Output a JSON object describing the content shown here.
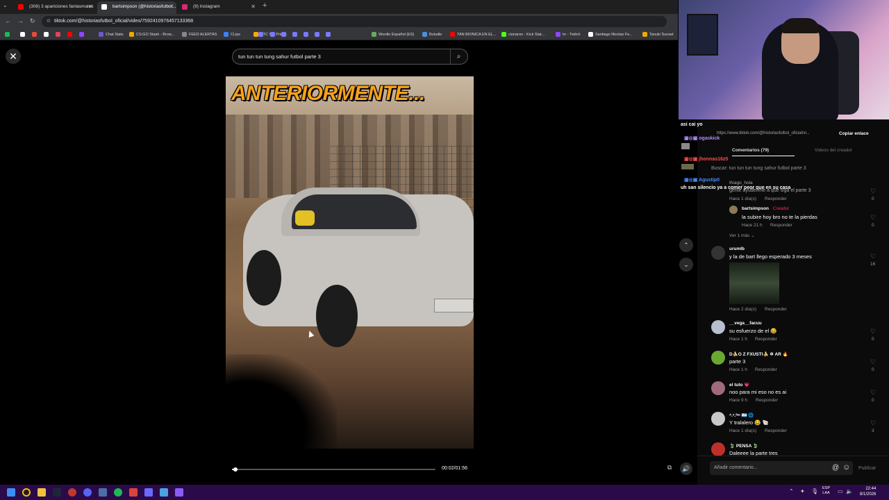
{
  "browser": {
    "tabs": [
      {
        "title": "(308) 3 apariciones fantasmales",
        "favicon_color": "#ff0000"
      },
      {
        "title": "bartsimpson (@historiasfutbol...",
        "favicon_color": "#ffffff"
      },
      {
        "title": "(9) Instagram",
        "favicon_color": "#d62976"
      }
    ],
    "new_tab": "+",
    "url": "tiktok.com/@historiasfutbol_oficial/video/7592410976457133368",
    "bookmarks": [
      {
        "label": "",
        "color": "#1db954"
      },
      {
        "label": "",
        "color": "#ffffff"
      },
      {
        "label": "",
        "color": "#e84b3c"
      },
      {
        "label": "",
        "color": "#ffffff"
      },
      {
        "label": "",
        "color": "#e4405f"
      },
      {
        "label": "",
        "color": "#ff0000"
      },
      {
        "label": "",
        "color": "#9146ff"
      },
      {
        "label": "Chat Stats",
        "color": "#6a5acd"
      },
      {
        "label": "CS:GO Stash - Brow...",
        "color": "#f0a800"
      },
      {
        "label": "FEED ALERTAS",
        "color": "#888888"
      },
      {
        "label": "CLips",
        "color": "#3b82f6"
      },
      {
        "label": "STC Set Prices",
        "color": "#ffaa00"
      },
      {
        "label": "Wordle Español (ES)",
        "color": "#6aaa64"
      },
      {
        "label": "Boludle",
        "color": "#4a90e2"
      },
      {
        "label": "TAN BIONICA EN EL...",
        "color": "#ff0000"
      },
      {
        "label": "cionaron - Kick Stat...",
        "color": "#53fc18"
      },
      {
        "label": "trr - Twitch",
        "color": "#9146ff"
      },
      {
        "label": "Santiago Nicolas Fe...",
        "color": "#ffffff"
      },
      {
        "label": "Tanuki Sunset",
        "color": "#f0a800"
      }
    ]
  },
  "viewer": {
    "search_value": "tun tun tun tung sahur futbol parte 3",
    "video_overlay_title": "ANTERIORMENTE...",
    "time": "00:02/01:56",
    "progress_fraction": 0.017
  },
  "stream_chat": {
    "caption": "asi cai yo",
    "users": [
      {
        "name": "ogaskick",
        "color": "#b48cff"
      },
      {
        "name": "jhonnas16z5",
        "color": "#ff4b4b"
      },
      {
        "name": "Agustip0",
        "color": "#4b8bff"
      }
    ],
    "last_message": "uh san silencio ya a comer peor que en su casa",
    "link_text": "https://www.tiktok.com/@historiasfutbol_oficial/vi...",
    "copy_link": "Copiar enlace",
    "tab_comments": "Comentarios (79)",
    "tab_creator_videos": "Videos del creador",
    "search_hint": "Buscar: tun tun tun tung sahur futbol parte 3",
    "partial_user": "thiago_hola",
    "partial_text": "gente ayúdenme a que siga el parte 3"
  },
  "comments": [
    {
      "meta": "Hace 1 día(s)",
      "reply": "Responder",
      "count": "0"
    },
    {
      "name": "bartsimpson",
      "creator": "· Creador",
      "text": "la subire hoy bro no te la pierdas",
      "meta": "Hace 21 h",
      "reply": "Responder",
      "count": "0",
      "color": "#8a7a5a"
    },
    {
      "more": "Ver 1 más"
    },
    {
      "name": "urumlb",
      "text": "y la de bart llego esperado 3 meses",
      "meta": "Hace 2 día(s)",
      "reply": "Responder",
      "count": "16",
      "color": "#333333",
      "image_caption": "image"
    },
    {
      "name": "__vega__facuu",
      "text": "su esfuerzo de el 😂",
      "meta": "Hace 1 h",
      "reply": "Responder",
      "count": "0",
      "color": "#b8c0d0"
    },
    {
      "name": "D🍌O Z FXUSTI🍌 ✡ AR 🔥",
      "text": "parte 3",
      "meta": "Hace 1 h",
      "reply": "Responder",
      "count": "0",
      "color": "#6aa832"
    },
    {
      "name": "el tuto 💗",
      "text": "noo para mi eso no es ai",
      "meta": "Hace 9 h",
      "reply": "Responder",
      "count": "0",
      "color": "#a06a7a"
    },
    {
      "name": "ᴬ.ᵉ.ᶠᵃᵃ 🇦🇷 🌐",
      "text": "Y tralalero 😂 🐚",
      "meta": "Hace 1 día(s)",
      "reply": "Responder",
      "count": "3",
      "color": "#c8c8c8"
    },
    {
      "name": "🍃 PENSA 🍃",
      "text": "Daleeee la parte tres",
      "color": "#c0302a"
    }
  ],
  "comment_box": {
    "placeholder": "Añadir comentario...",
    "publish": "Publicar"
  },
  "taskbar": {
    "lang_line1": "ESP",
    "lang_line2": "LAA",
    "time": "22:44",
    "date": "8/1/2026"
  }
}
